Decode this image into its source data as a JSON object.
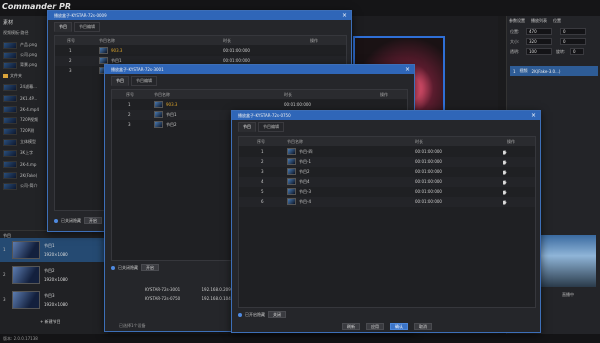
{
  "app": {
    "brand": "Commander PR",
    "status": "版本: 2.0.0.17138"
  },
  "resources": {
    "header": "素材",
    "sub": "视频模板-路径",
    "items": [
      "产品.png",
      "公司.png",
      "背景.png"
    ],
    "folder": "文件夹",
    "media": [
      "24滤幕... ",
      "2K1.4P...",
      "2K-4.mp4",
      "720P视频",
      "720P测",
      "立体模型",
      "3K上字",
      "2K-4.mp",
      "2K(Fake)",
      "公司-简介"
    ]
  },
  "programs": {
    "header": "节目",
    "rows": [
      {
        "num": "1",
        "name": "节目1",
        "res": "1920×1080"
      },
      {
        "num": "2",
        "name": "节目2",
        "res": "1920×1080"
      },
      {
        "num": "3",
        "name": "节目3",
        "res": "1920×1080"
      }
    ],
    "add_label": "新建节目"
  },
  "right_panel": {
    "tabs": [
      "参数设置",
      "播放列表",
      "位置"
    ],
    "labels": {
      "pos": "位置:",
      "size": "大小:",
      "opacity": "透明:",
      "rotate": "旋转:"
    },
    "values": {
      "x": "470",
      "y": "0",
      "w": "320",
      "h": "0",
      "opacity": "100",
      "rotate": "0"
    },
    "list_row": {
      "idx": "1",
      "name": "视频",
      "file": "2K(Fake-3.0...)"
    },
    "bottom_caption": "直播中"
  },
  "dialog1": {
    "title": "播放盒子-KYSTAR-72s-0009",
    "tabs": [
      "节目",
      "节目编辑"
    ],
    "head": [
      "序号",
      "节目名称",
      "时长",
      "操作"
    ],
    "rows": [
      {
        "idx": "1",
        "name": "903.3",
        "dur": "00:01:00:000"
      },
      {
        "idx": "2",
        "name": "节目1",
        "dur": "00:01:00:000"
      },
      {
        "idx": "3",
        "name": "节目2",
        "dur": "00:01:00:000"
      }
    ],
    "status": "已关闭隐藏",
    "btn": "开启"
  },
  "dialog2": {
    "title": "播放盒子-KYSTAR-72s-3001",
    "tabs": [
      "节目",
      "节目编辑"
    ],
    "head": [
      "序号",
      "节目名称",
      "时长",
      "操作"
    ],
    "rows": [
      {
        "idx": "1",
        "name": "903.3",
        "dur": "00:01:00:000"
      },
      {
        "idx": "2",
        "name": "节目1",
        "dur": "00:01:00:000"
      },
      {
        "idx": "3",
        "name": "节目2",
        "dur": "00:01:00:000"
      }
    ],
    "status": "已关闭隐藏",
    "btn": "开启",
    "devices": [
      {
        "name": "KYSTAR-72s-3001",
        "ip": "192.168.0.209"
      },
      {
        "name": "KYSTAR-72s-0750",
        "ip": "192.168.0.104"
      }
    ],
    "footer": "已选择1个设备"
  },
  "dialog3": {
    "title": "播放盒子-KYSTAR-72s-0750",
    "tabs": [
      "节目",
      "节目编辑"
    ],
    "head": [
      "序号",
      "节目名称",
      "时长",
      "操作"
    ],
    "rows": [
      {
        "idx": "1",
        "name": "节目-四",
        "dur": "00:01:00:000"
      },
      {
        "idx": "2",
        "name": "节目-1",
        "dur": "00:01:00:000"
      },
      {
        "idx": "3",
        "name": "节目2",
        "dur": "00:01:00:000"
      },
      {
        "idx": "4",
        "name": "节目4",
        "dur": "00:01:00:000"
      },
      {
        "idx": "5",
        "name": "节目-3",
        "dur": "00:01:00:000"
      },
      {
        "idx": "6",
        "name": "节目-4",
        "dur": "00:01:00:000"
      }
    ],
    "status": "已开启隐藏",
    "btn": "关闭",
    "footer_buttons": [
      "刷新",
      "应用",
      "确认",
      "取消"
    ]
  },
  "colors": {
    "accent": "#2f66b8",
    "gold": "#e0a62a"
  }
}
